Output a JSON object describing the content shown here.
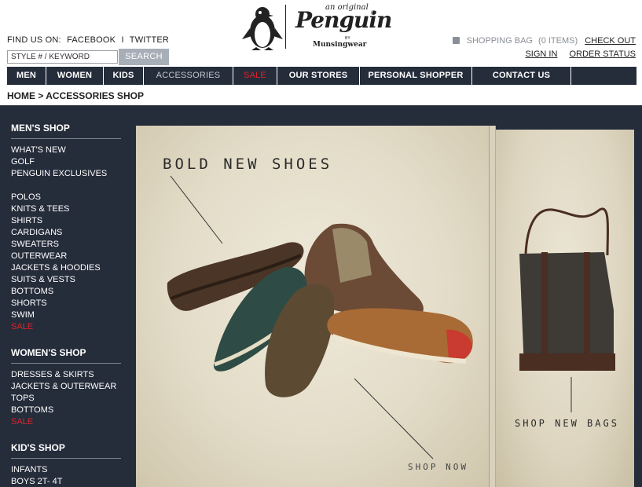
{
  "header": {
    "find_us": "FIND US ON:",
    "facebook": "FACEBOOK",
    "separator": "I",
    "twitter": "TWITTER",
    "search_placeholder": "STYLE # / KEYWORD",
    "search_button": "SEARCH"
  },
  "logo": {
    "line1": "an original",
    "brand": "Penguin",
    "reg": "®",
    "by": "BY",
    "sub": "Munsingwear"
  },
  "account": {
    "bag_label": "SHOPPING BAG",
    "bag_count": "(0 ITEMS)",
    "checkout": "CHECK OUT",
    "sign_in": "SIGN IN",
    "order_status": "ORDER STATUS"
  },
  "nav": {
    "items": [
      {
        "label": "MEN"
      },
      {
        "label": "WOMEN"
      },
      {
        "label": "KIDS"
      },
      {
        "label": "ACCESSORIES"
      },
      {
        "label": "SALE"
      },
      {
        "label": "OUR STORES"
      },
      {
        "label": "PERSONAL SHOPPER"
      },
      {
        "label": "CONTACT US"
      }
    ]
  },
  "breadcrumb": {
    "home": "HOME",
    "arrow": ">",
    "current": "ACCESSORIES SHOP"
  },
  "sidebar": {
    "mens_title": "MEN'S SHOP",
    "mens_group1": [
      "WHAT'S NEW",
      "GOLF",
      "PENGUIN EXCLUSIVES"
    ],
    "mens_group2": [
      "POLOS",
      "KNITS & TEES",
      "SHIRTS",
      "CARDIGANS",
      "SWEATERS",
      "OUTERWEAR",
      "JACKETS & HOODIES",
      "SUITS & VESTS",
      "BOTTOMS",
      "SHORTS",
      "SWIM"
    ],
    "mens_sale": "SALE",
    "womens_title": "WOMEN'S SHOP",
    "womens_items": [
      "DRESSES & SKIRTS",
      "JACKETS & OUTERWEAR",
      "TOPS",
      "BOTTOMS"
    ],
    "womens_sale": "SALE",
    "kids_title": "KID'S SHOP",
    "kids_items": [
      "INFANTS",
      "BOYS 2T- 4T"
    ]
  },
  "hero": {
    "title": "BOLD NEW SHOES",
    "cta": "SHOP NOW",
    "bags_cta": "SHOP NEW BAGS"
  },
  "colors": {
    "navy": "#252c3a",
    "sale_red": "#e0232a",
    "paper": "#e8e1ce"
  }
}
